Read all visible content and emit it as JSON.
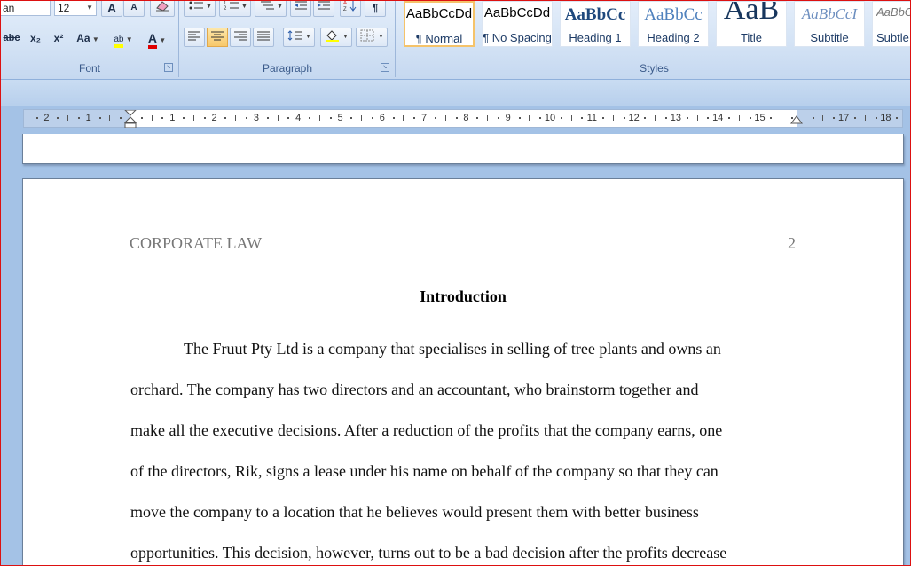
{
  "ribbon": {
    "font": {
      "font_name": "an",
      "font_size": "12",
      "grow_label": "A",
      "shrink_label": "A",
      "strike_label": "abc",
      "subscript_label": "x₂",
      "superscript_label": "x²",
      "change_case_label": "Aa",
      "highlight_label": "ab",
      "font_color_label": "A",
      "group_label": "Font"
    },
    "paragraph": {
      "group_label": "Paragraph"
    },
    "styles": {
      "group_label": "Styles",
      "items": [
        {
          "sample": "AaBbCcDd",
          "name": "¶ Normal"
        },
        {
          "sample": "AaBbCcDd",
          "name": "¶ No Spacing"
        },
        {
          "sample": "AaBbCc",
          "name": "Heading 1"
        },
        {
          "sample": "AaBbCc",
          "name": "Heading 2"
        },
        {
          "sample": "AaB",
          "name": "Title"
        },
        {
          "sample": "AaBbCcI",
          "name": "Subtitle"
        },
        {
          "sample": "AaBbC",
          "name": "Subtle"
        }
      ]
    }
  },
  "ruler": {
    "numbers": [
      "2",
      "1",
      "1",
      "2",
      "3",
      "4",
      "5",
      "6",
      "7",
      "8",
      "9",
      "10",
      "11",
      "12",
      "13",
      "14",
      "15",
      "17",
      "18"
    ]
  },
  "document": {
    "header_title": "CORPORATE LAW",
    "page_number": "2",
    "heading": "Introduction",
    "lines": [
      "The Fruut Pty Ltd is a company that specialises in selling of tree plants and owns an",
      "orchard. The company has two directors and an accountant, who brainstorm together and",
      "make all the executive decisions. After a reduction of the profits that the company earns, one",
      "of the directors, Rik, signs a lease under his name on behalf of the company so that they can",
      "move the company to a location that he believes would present them with better business",
      "opportunities. This decision, however, turns out to be a bad decision after the profits decrease"
    ]
  },
  "colors": {
    "highlight": "#ffff00",
    "font_color": "#e00000",
    "selected_style_border": "#f5c36a",
    "workspace": "#a4c2e6"
  }
}
